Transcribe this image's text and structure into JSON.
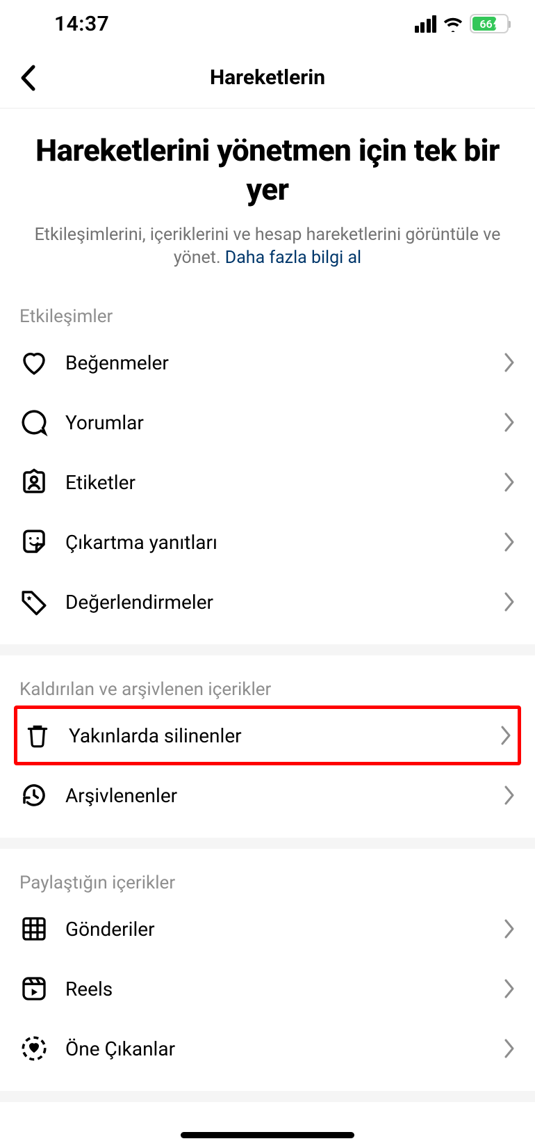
{
  "status": {
    "time": "14:37",
    "battery_pct": "66"
  },
  "navbar": {
    "title": "Hareketlerin"
  },
  "hero": {
    "title": "Hareketlerini yönetmen için tek bir yer",
    "subtitle_pre": "Etkileşimlerini, içeriklerini ve hesap hareketlerini görüntüle ve yönet. ",
    "learn_more": "Daha fazla bilgi al"
  },
  "sections": {
    "interactions": {
      "header": "Etkileşimler",
      "items": {
        "likes": "Beğenmeler",
        "comments": "Yorumlar",
        "tags": "Etiketler",
        "sticker_replies": "Çıkartma yanıtları",
        "reviews": "Değerlendirmeler"
      }
    },
    "removed": {
      "header": "Kaldırılan ve arşivlenen içerikler",
      "items": {
        "recently_deleted": "Yakınlarda silinenler",
        "archived": "Arşivlenenler"
      }
    },
    "shared": {
      "header": "Paylaştığın içerikler",
      "items": {
        "posts": "Gönderiler",
        "reels": "Reels",
        "highlights": "Öne Çıkanlar"
      }
    }
  }
}
